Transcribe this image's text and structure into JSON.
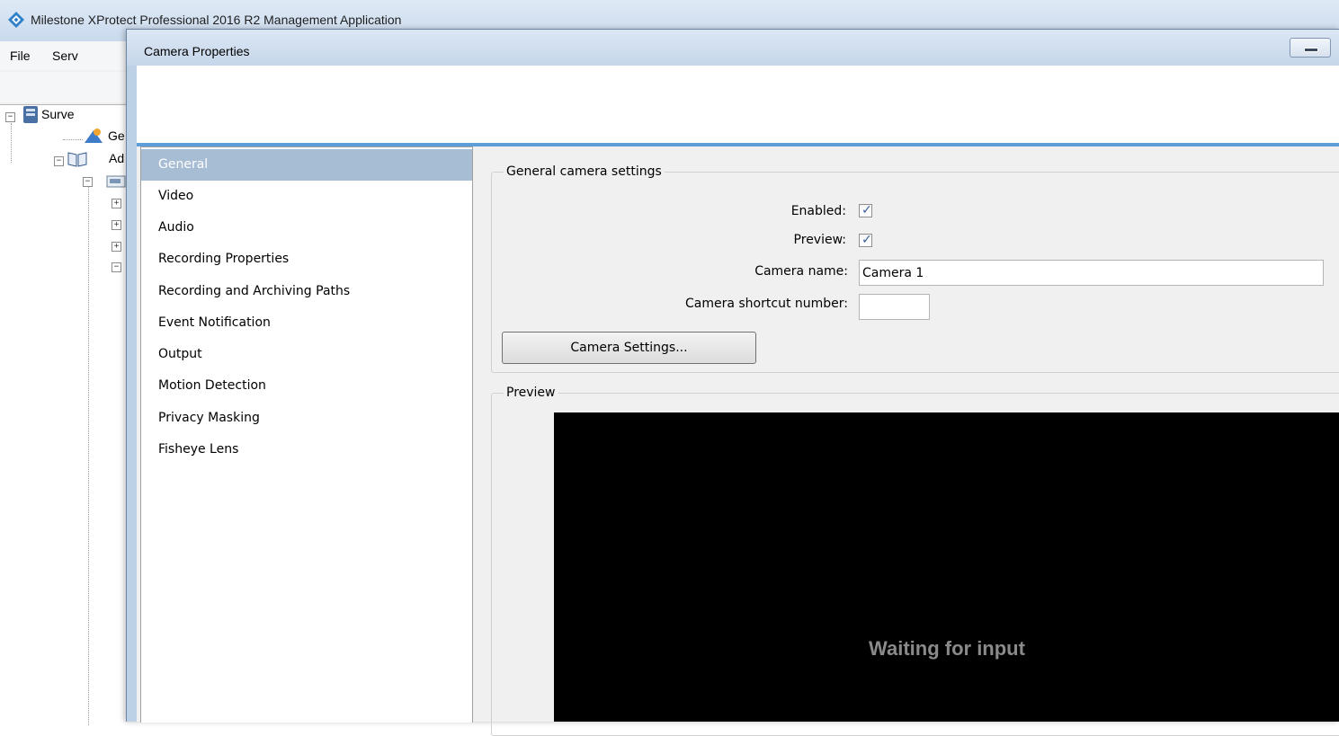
{
  "background_app": {
    "title": "Milestone XProtect Professional 2016 R2 Management Application",
    "menu": [
      "File",
      "Serv"
    ],
    "tree": [
      {
        "label": "Surve"
      },
      {
        "label": "Ge"
      },
      {
        "label": "Ad"
      }
    ]
  },
  "dialog": {
    "title": "Camera Properties"
  },
  "nav": {
    "items": [
      {
        "label": "General"
      },
      {
        "label": "Video"
      },
      {
        "label": "Audio"
      },
      {
        "label": "Recording Properties"
      },
      {
        "label": "Recording and Archiving Paths"
      },
      {
        "label": "Event Notification"
      },
      {
        "label": "Output"
      },
      {
        "label": "Motion Detection"
      },
      {
        "label": "Privacy Masking"
      },
      {
        "label": "Fisheye Lens"
      }
    ],
    "selected": "General"
  },
  "general_settings": {
    "legend": "General camera settings",
    "enabled_label": "Enabled:",
    "enabled_checked": true,
    "preview_label": "Preview:",
    "preview_checked": true,
    "camera_name_label": "Camera name:",
    "camera_name_value": "Camera 1",
    "shortcut_label": "Camera shortcut number:",
    "shortcut_value": "",
    "camera_settings_button": "Camera Settings..."
  },
  "preview": {
    "legend": "Preview",
    "status_text": "Waiting for input"
  },
  "colors": {
    "selected_nav": "#a7bdd4",
    "header_accent": "#5d9ed9",
    "preview_bg": "#000000"
  }
}
